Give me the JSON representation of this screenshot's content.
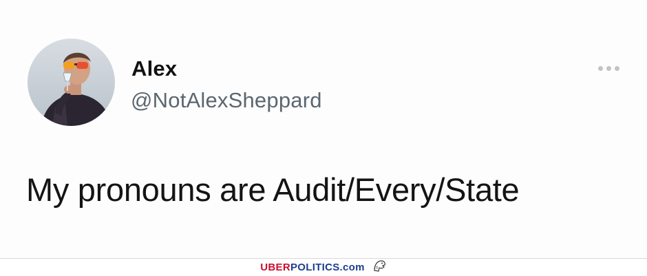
{
  "tweet": {
    "display_name": "Alex",
    "handle": "@NotAlexSheppard",
    "text": "My pronouns are Audit/Every/State",
    "more_icon": "more-horizontal-icon",
    "avatar_icon": "profile-photo"
  },
  "watermark": {
    "brand_part1": "UBER",
    "brand_part2": "POLITICS.com",
    "logo_icon": "eagle-icon",
    "colors": {
      "red": "#c8102e",
      "blue": "#1d3d8f"
    }
  }
}
